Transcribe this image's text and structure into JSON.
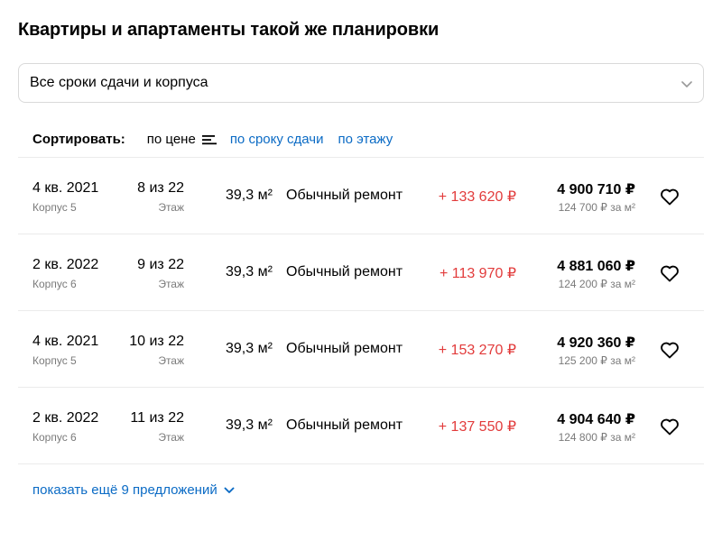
{
  "title": "Квартиры и апартаменты такой же планировки",
  "filter": {
    "selected": "Все сроки сдачи и корпуса"
  },
  "sort": {
    "label": "Сортировать:",
    "options": [
      {
        "label": "по цене",
        "active": true
      },
      {
        "label": "по сроку сдачи",
        "active": false
      },
      {
        "label": "по этажу",
        "active": false
      }
    ]
  },
  "rows": [
    {
      "date": "4 кв. 2021",
      "corpus": "Корпус 5",
      "floor": "8 из 22",
      "floor_label": "Этаж",
      "area": "39,3 м²",
      "repair": "Обычный ремонт",
      "diff": "+ 133 620 ₽",
      "price": "4 900 710 ₽",
      "price_per_m": "124 700 ₽ за м²"
    },
    {
      "date": "2 кв. 2022",
      "corpus": "Корпус 6",
      "floor": "9 из 22",
      "floor_label": "Этаж",
      "area": "39,3 м²",
      "repair": "Обычный ремонт",
      "diff": "+ 113 970 ₽",
      "price": "4 881 060 ₽",
      "price_per_m": "124 200 ₽ за м²"
    },
    {
      "date": "4 кв. 2021",
      "corpus": "Корпус 5",
      "floor": "10 из 22",
      "floor_label": "Этаж",
      "area": "39,3 м²",
      "repair": "Обычный ремонт",
      "diff": "+ 153 270 ₽",
      "price": "4 920 360 ₽",
      "price_per_m": "125 200 ₽ за м²"
    },
    {
      "date": "2 кв. 2022",
      "corpus": "Корпус 6",
      "floor": "11 из 22",
      "floor_label": "Этаж",
      "area": "39,3 м²",
      "repair": "Обычный ремонт",
      "diff": "+ 137 550 ₽",
      "price": "4 904 640 ₽",
      "price_per_m": "124 800 ₽ за м²"
    }
  ],
  "show_more": "показать ещё 9 предложений",
  "colors": {
    "link": "#0b6bc5",
    "diff": "#e23b3b",
    "muted": "#7a7a7a",
    "border": "#ebebeb"
  },
  "icons": {
    "select": "chevron-down-icon",
    "sort": "sort-descending-icon",
    "favorite": "heart-icon",
    "more": "chevron-down-icon"
  }
}
